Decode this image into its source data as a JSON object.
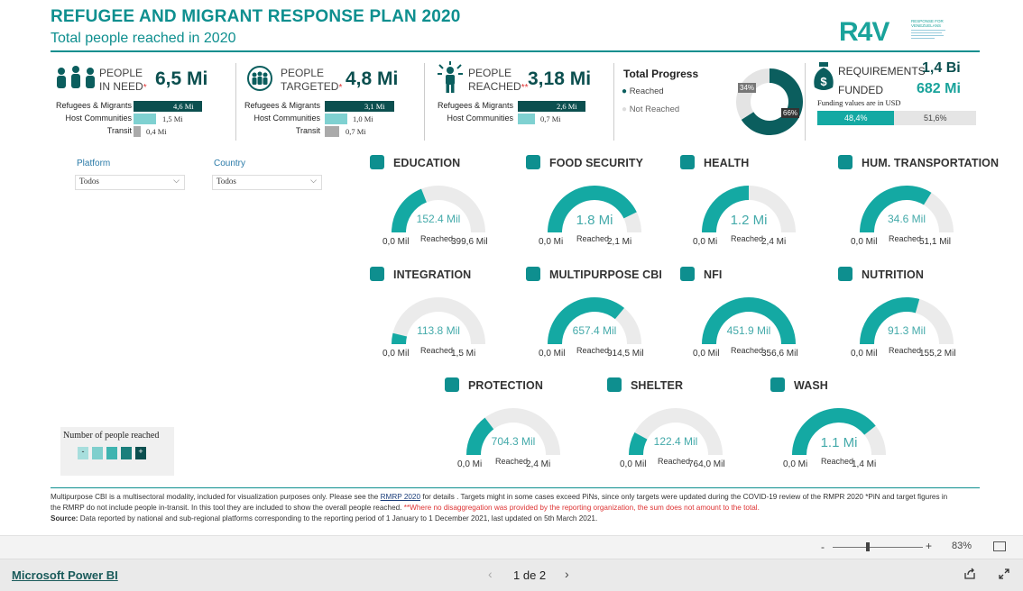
{
  "header": {
    "title": "REFUGEE AND MIGRANT RESPONSE PLAN 2020",
    "subtitle": "Total people reached in 2020",
    "logo_text": "R4V",
    "logo_sub": "RESPONSE FOR VENEZUELANS"
  },
  "kpis": {
    "pin": {
      "label1": "PEOPLE",
      "label2": "IN NEED",
      "value": "6,5 Mi",
      "rows": [
        {
          "cat": "Refugees & Migrants",
          "val": "4,6 Mi"
        },
        {
          "cat": "Host Communities",
          "val": "1,5 Mi"
        },
        {
          "cat": "Transit",
          "val": "0,4 Mi"
        }
      ]
    },
    "targeted": {
      "label1": "PEOPLE",
      "label2": "TARGETED",
      "value": "4,8 Mi",
      "rows": [
        {
          "cat": "Refugees & Migrants",
          "val": "3,1 Mi"
        },
        {
          "cat": "Host Communities",
          "val": "1,0 Mi"
        },
        {
          "cat": "Transit",
          "val": "0,7 Mi"
        }
      ]
    },
    "reached": {
      "label1": "PEOPLE",
      "label2": "REACHED",
      "value": "3,18 Mi",
      "rows": [
        {
          "cat": "Refugees & Migrants",
          "val": "2,6 Mi"
        },
        {
          "cat": "Host Communities",
          "val": "0,7 Mi"
        }
      ]
    }
  },
  "progress": {
    "title": "Total Progress",
    "legend_reached": "Reached",
    "legend_not": "Not Reached",
    "reached_pct": 66,
    "reached_label": "66%",
    "not_label": "34%"
  },
  "funding": {
    "req_label": "REQUIREMENTS",
    "req_value": "1,4 Bi",
    "funded_label": "FUNDED",
    "funded_value": "682 Mi",
    "note": "Funding values are in USD",
    "funded_pct_label": "48,4%",
    "unfunded_pct_label": "51,6%",
    "funded_pct": 48.4
  },
  "filters": {
    "platform_label": "Platform",
    "platform_value": "Todos",
    "country_label": "Country",
    "country_value": "Todos"
  },
  "sectors": [
    {
      "name": "EDUCATION",
      "center": "152.4 Mil",
      "min": "0,0 Mil",
      "max": "399,6 Mil",
      "reached": "Reached",
      "ratio": 0.381
    },
    {
      "name": "FOOD SECURITY",
      "center": "1.8 Mi",
      "min": "0,0 Mi",
      "max": "2,1 Mi",
      "reached": "Reached",
      "ratio": 0.857
    },
    {
      "name": "HEALTH",
      "center": "1.2 Mi",
      "min": "0,0 Mi",
      "max": "2,4 Mi",
      "reached": "Reached",
      "ratio": 0.5
    },
    {
      "name": "HUM. TRANSPORTATION",
      "center": "34.6 Mil",
      "min": "0,0 Mil",
      "max": "51,1 Mil",
      "reached": "Reached",
      "ratio": 0.677
    },
    {
      "name": "INTEGRATION",
      "center": "113.8 Mil",
      "min": "0,0 Mil",
      "max": "1,5 Mi",
      "reached": "Reached",
      "ratio": 0.076
    },
    {
      "name": "MULTIPURPOSE CBI",
      "center": "657.4 Mil",
      "min": "0,0 Mil",
      "max": "914,5 Mil",
      "reached": "Reached",
      "ratio": 0.719
    },
    {
      "name": "NFI",
      "center": "451.9 Mil",
      "min": "0,0 Mil",
      "max": "356,6 Mil",
      "reached": "Reached",
      "ratio": 1.0
    },
    {
      "name": "NUTRITION",
      "center": "91.3 Mil",
      "min": "0,0 Mil",
      "max": "155,2 Mil",
      "reached": "Reached",
      "ratio": 0.588
    },
    {
      "name": "PROTECTION",
      "center": "704.3 Mil",
      "min": "0,0 Mi",
      "max": "2,4 Mi",
      "reached": "Reached",
      "ratio": 0.293
    },
    {
      "name": "SHELTER",
      "center": "122.4 Mil",
      "min": "0,0 Mil",
      "max": "764,0 Mil",
      "reached": "Reached",
      "ratio": 0.16
    },
    {
      "name": "WASH",
      "center": "1.1 Mi",
      "min": "0,0 Mi",
      "max": "1,4 Mi",
      "reached": "Reached",
      "ratio": 0.786
    }
  ],
  "legend": {
    "title": "Number of people reached",
    "minus": "-",
    "plus": "+"
  },
  "notes": {
    "line1a": "Multipurpose CBI is a multisectoral modality, included for visualization purposes only. Please see the ",
    "link": "RMRP 2020",
    "line1b": " for details .  Targets might in some cases exceed PiNs, since only targets were updated during the COVID-19 review of the RMPR 2020 *PiN and target figures in",
    "line2a": "the RMRP do not include people in-transit. In this tool they are included to  show the overall people reached. ",
    "line2b": "**Where no disaggregation was provided by the reporting organization, the sum does not amount to the total.",
    "source_label": "Source:",
    "source_text": " Data reported  by national and sub-regional platforms corresponding to the reporting period of 1 January to 1 December 2021, last updated on 5th March 2021."
  },
  "status": {
    "zoom": "83%",
    "minus": "-",
    "plus": "+"
  },
  "bottom": {
    "brand": "Microsoft Power BI",
    "page": "1 de 2"
  },
  "colors": {
    "teal": "#0e8f8f",
    "dark_teal": "#0b5e5e",
    "light_teal": "#7fd1d1",
    "gauge_bg": "#ebebeb",
    "gauge_fill": "#14a9a3"
  }
}
